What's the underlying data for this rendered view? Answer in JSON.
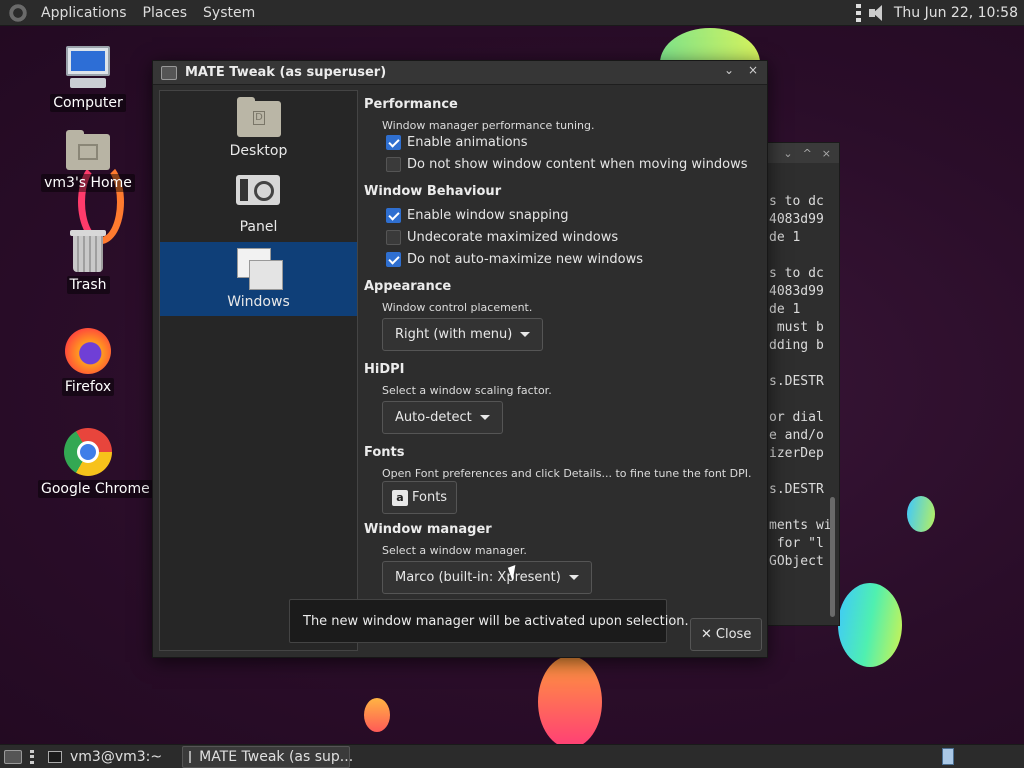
{
  "top_panel": {
    "menus": [
      "Applications",
      "Places",
      "System"
    ],
    "clock": "Thu Jun 22, 10:58",
    "icons": [
      "mate-menu-icon",
      "dots-icon",
      "speaker-icon"
    ]
  },
  "desktop_icons": [
    {
      "label": "Computer",
      "icon": "computer-icon"
    },
    {
      "label": "vm3's Home",
      "icon": "home-folder-icon"
    },
    {
      "label": "Trash",
      "icon": "trash-icon"
    },
    {
      "label": "Firefox",
      "icon": "firefox-icon"
    },
    {
      "label": "Google Chrome",
      "icon": "chrome-icon"
    }
  ],
  "terminal": {
    "lines": [
      "s to dc",
      "4083d99",
      "de 1",
      "",
      "s to dc",
      "4083d99",
      "de 1",
      " must b",
      "dding b",
      "",
      "s.DESTR",
      "",
      "or dial",
      "e and/o",
      "izerDep",
      "",
      "s.DESTR",
      "",
      "ments wi",
      " for \"l",
      "GObject"
    ]
  },
  "dialog": {
    "title": "MATE Tweak (as superuser)",
    "controls": {
      "minimize": "⌄",
      "close": "×"
    },
    "sidebar": [
      {
        "label": "Desktop",
        "icon": "desktop-folder-icon",
        "active": false
      },
      {
        "label": "Panel",
        "icon": "panel-icon",
        "active": false
      },
      {
        "label": "Windows",
        "icon": "windows-icon",
        "active": true
      }
    ],
    "performance": {
      "title": "Performance",
      "desc": "Window manager performance tuning.",
      "options": [
        {
          "label": "Enable animations",
          "checked": true
        },
        {
          "label": "Do not show window content when moving windows",
          "checked": false
        }
      ]
    },
    "behaviour": {
      "title": "Window Behaviour",
      "options": [
        {
          "label": "Enable window snapping",
          "checked": true
        },
        {
          "label": "Undecorate maximized windows",
          "checked": false
        },
        {
          "label": "Do not auto-maximize new windows",
          "checked": true
        }
      ]
    },
    "appearance": {
      "title": "Appearance",
      "desc": "Window control placement.",
      "value": "Right (with menu)"
    },
    "hidpi": {
      "title": "HiDPI",
      "desc": "Select a window scaling factor.",
      "value": "Auto-detect"
    },
    "fonts": {
      "title": "Fonts",
      "desc": "Open Font preferences and click Details... to fine tune the font DPI.",
      "button": "Fonts"
    },
    "wm": {
      "title": "Window manager",
      "desc": "Select a window manager.",
      "value": "Marco (built-in: Xpresent)"
    },
    "tooltip": "The new window manager will be activated upon selection.",
    "close_button": "Close"
  },
  "bottom_panel": {
    "tasks": [
      "vm3@vm3:~",
      "MATE Tweak (as sup..."
    ]
  }
}
